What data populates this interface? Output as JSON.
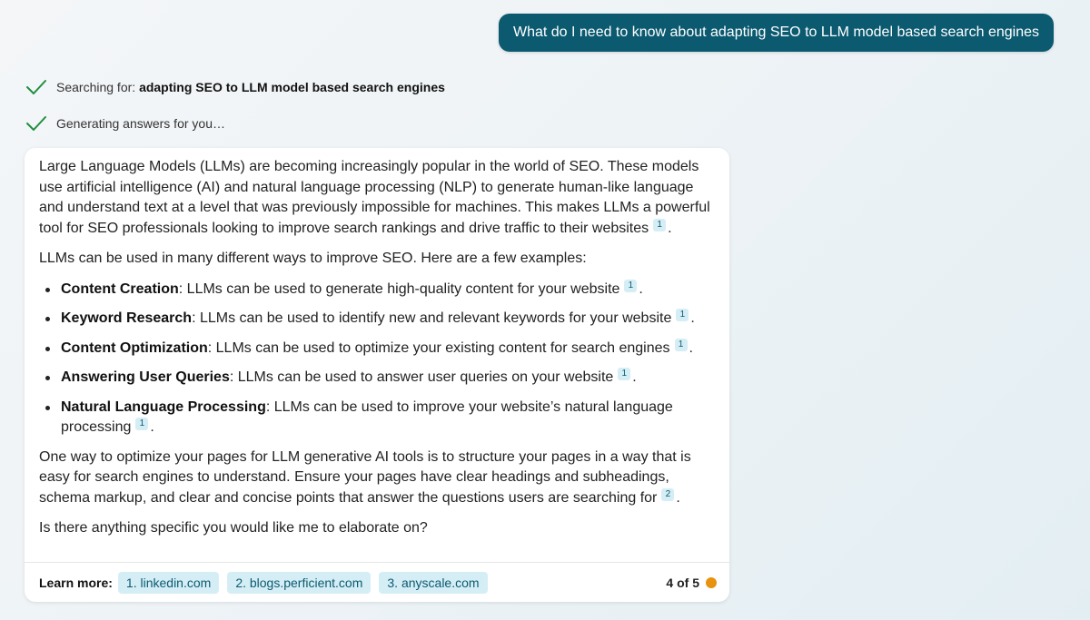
{
  "user_message": "What do I need to know about adapting SEO to LLM model based search engines",
  "status": {
    "searching_prefix": "Searching for: ",
    "searching_query": "adapting SEO to LLM model based search engines",
    "generating": "Generating answers for you…"
  },
  "answer": {
    "para1": "Large Language Models (LLMs) are becoming increasingly popular in the world of SEO. These models use artificial intelligence (AI) and natural language processing (NLP) to generate human-like language and understand text at a level that was previously impossible for machines. This makes LLMs a powerful tool for SEO professionals looking to improve search rankings and drive traffic to their websites",
    "para1_cite": "1",
    "para2": "LLMs can be used in many different ways to improve SEO. Here are a few examples:",
    "bullets": [
      {
        "title": "Content Creation",
        "text": ": LLMs can be used to generate high-quality content for your website",
        "cite": "1"
      },
      {
        "title": "Keyword Research",
        "text": ": LLMs can be used to identify new and relevant keywords for your website",
        "cite": "1"
      },
      {
        "title": "Content Optimization",
        "text": ": LLMs can be used to optimize your existing content for search engines",
        "cite": "1"
      },
      {
        "title": "Answering User Queries",
        "text": ": LLMs can be used to answer user queries on your website",
        "cite": "1"
      },
      {
        "title": "Natural Language Processing",
        "text": ": LLMs can be used to improve your website’s natural language processing",
        "cite": "1"
      }
    ],
    "para3": "One way to optimize your pages for LLM generative AI tools is to structure your pages in a way that is easy for search engines to understand. Ensure your pages have clear headings and subheadings, schema markup, and clear and concise points that answer the questions users are searching for",
    "para3_cite": "2",
    "para4": "Is there anything specific you would like me to elaborate on?"
  },
  "learn_more": {
    "label": "Learn more:",
    "links": [
      "1. linkedin.com",
      "2. blogs.perficient.com",
      "3. anyscale.com"
    ],
    "counter": "4 of 5"
  },
  "colors": {
    "accent": "#0b5a70",
    "check": "#1e8e3e",
    "chip_bg": "#d5eef5",
    "counter_dot": "#e8920f"
  }
}
